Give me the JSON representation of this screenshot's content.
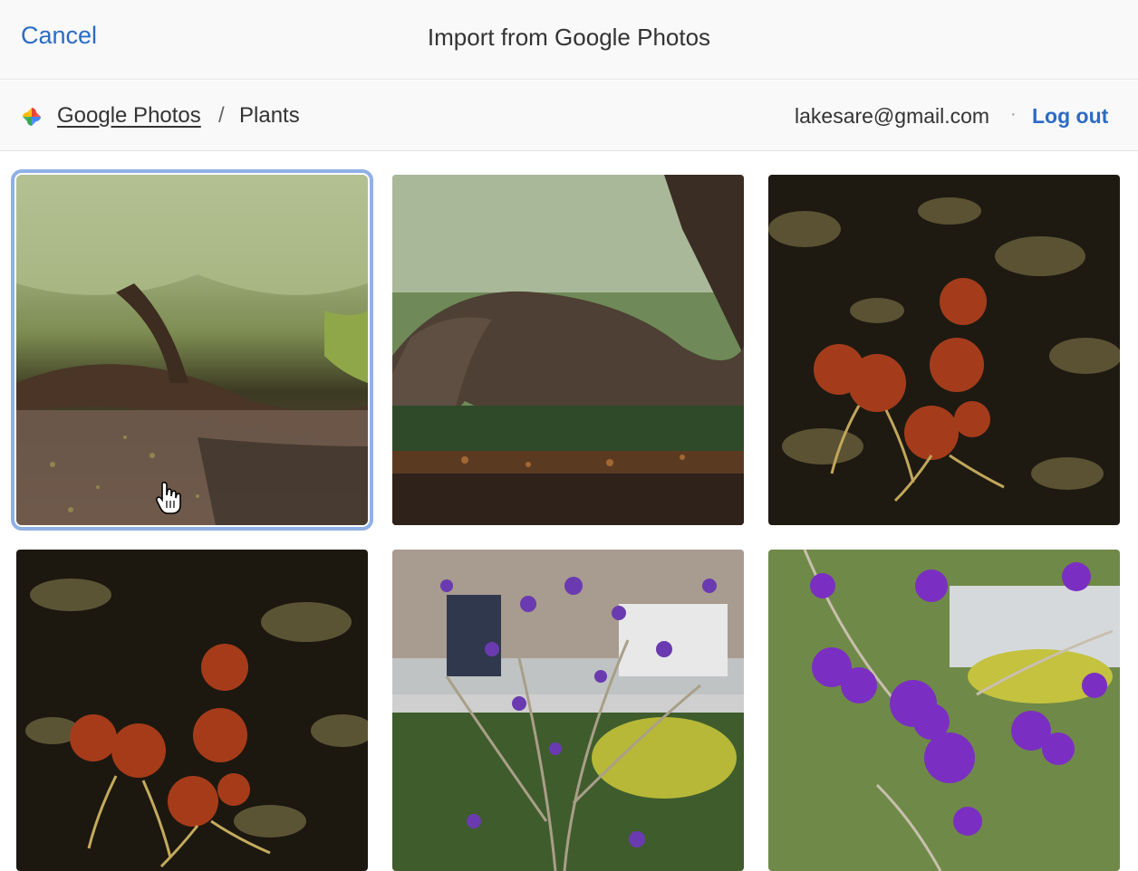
{
  "header": {
    "cancel_label": "Cancel",
    "title": "Import from Google Photos"
  },
  "breadcrumb": {
    "root": "Google Photos",
    "separator": "/",
    "current": "Plants"
  },
  "account": {
    "email": "lakesare@gmail.com",
    "separator": "·",
    "logout_label": "Log out"
  },
  "colors": {
    "link": "#2c6bc4",
    "selection_outline": "#8fb1e5"
  },
  "photos": [
    {
      "subject": "willow-tree-path",
      "selected": true
    },
    {
      "subject": "twisted-tree-trunk",
      "selected": false
    },
    {
      "subject": "rose-hips-night",
      "selected": false
    },
    {
      "subject": "rose-hips-night-2",
      "selected": false
    },
    {
      "subject": "purple-berry-shrub",
      "selected": false
    },
    {
      "subject": "purple-berries-closeup",
      "selected": false
    }
  ]
}
